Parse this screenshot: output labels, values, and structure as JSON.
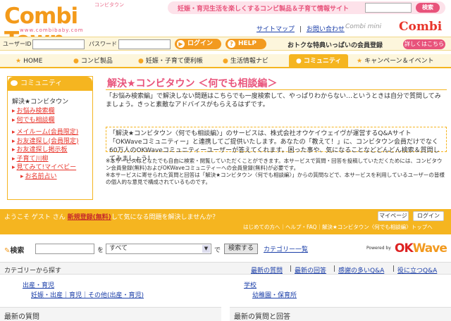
{
  "header": {
    "logo_text": "Combi Town",
    "logo_kana": "コンビタウン",
    "logo_url": "www.combibaby.com",
    "tagline": "妊娠・育児生活を楽しくするコンビ製品＆子育て情報サイト",
    "top_search_button": "検索",
    "links": [
      "サイトマップ",
      "お問い合わせ"
    ],
    "combi_mini": "Combi mini",
    "brand": "Combi"
  },
  "login_bar": {
    "user_label": "ユーザーID",
    "password_label": "パスワード",
    "login_button": "ログイン",
    "help_button": "HELP",
    "member_text": "おトクな特典いっぱいの会員登録",
    "member_button": "詳しくはこちら"
  },
  "nav": [
    {
      "label": "HOME",
      "icon": "star-icon"
    },
    {
      "label": "コンビ製品",
      "icon": "bottle-icon"
    },
    {
      "label": "妊娠・子育て便利帳",
      "icon": "note-icon"
    },
    {
      "label": "生活情報ナビ",
      "icon": "bulb-icon"
    },
    {
      "label": "コミュニティ",
      "icon": "chat-icon",
      "active": true
    },
    {
      "label": "キャンペーン＆イベント",
      "icon": "star-icon"
    }
  ],
  "sidebar": {
    "heading": "コミュニティ",
    "title": "解決★コンビタウン",
    "items": [
      {
        "label": "お悩み検索欄",
        "sub": false
      },
      {
        "label": "何でも相談欄",
        "sub": false
      },
      {
        "label": "メイルーム(会員限定)",
        "sub": false
      },
      {
        "label": "お友達探し(会員限定)",
        "sub": false
      },
      {
        "label": "お友達探し掲示板",
        "sub": false
      },
      {
        "label": "子育て川柳",
        "sub": false
      },
      {
        "label": "見てみて!マイベビー",
        "sub": false
      },
      {
        "label": "お名前占い",
        "sub": true
      }
    ]
  },
  "main": {
    "title": "解決★コンビタウン ＜何でも相談編＞",
    "intro": "「お悩み検索編」で解決しない問題はこちらでも一度検索して、やっぱりわからない…というときは自分で質問してみましょう。きっと素敵なアドバイスがもらえるはずです。",
    "description": "「解決★コンビタウン〈何でも相談編〉」のサービスは、株式会社オウケイウェイヴが運営するQ&Aサイト「OKWaveコミュニティー」と連携してご提供いたします。あなたの「教えて！」に、コンビタウン会員だけでなく60万人のOKWaveコミュニティーユーザーが答えてくれます。困った事や、気になることなどどんどん検索＆質問してみましょう！",
    "notes": [
      "※本サービスはどなたでも自由に検索・閲覧していただくことができます。本サービスで質問・回答を投稿していただくためには、コンビタウン会員登録(無料)およびOKWaveコミュニティーへの会員登録(無料)が必要です。",
      "※本サービスに寄せられた質問と回答は「解決★コンビタウン〈何でも相談編〉」からの質問などで、本サービスを利用しているユーザーの皆様の個人的な意見で構成されているものです。"
    ]
  },
  "welcome": {
    "prefix": "ようこそ ゲスト さん ",
    "register_link": "新規登録(無料)",
    "suffix": "して気になる問題を解決しませんか？",
    "mypage_button": "マイページ",
    "login_button": "ログイン",
    "sub_links": "はじめての方へ｜ヘルプ・FAQ｜解決★コンビタウン〈何でも相談編〉トップへ"
  },
  "search": {
    "label": "検索",
    "wo": "を",
    "select_value": "すべて",
    "de": "で",
    "button": "検索する",
    "category_link": "カテゴリー一覧",
    "powered_by": "Powered by",
    "okwave_ok": "OK",
    "okwave_wave": "Wave"
  },
  "categories": {
    "heading": "カテゴリーから探す",
    "tabs": [
      "最新の質問",
      "最新の回答",
      "感謝の多いQ&A",
      "役に立つQ&A"
    ],
    "groups": [
      {
        "title": "出産・育児",
        "children": "妊娠・出産｜育児｜その他(出産・育児)"
      },
      {
        "title": "学校",
        "children": "幼稚園・保育所"
      }
    ]
  },
  "bottom": {
    "left_heading": "最新の質問",
    "right_heading": "最新の質問と回答"
  },
  "colors": {
    "accent_orange": "#f5b520",
    "brand_pink": "#e8537b",
    "brand_red": "#e8342a"
  }
}
